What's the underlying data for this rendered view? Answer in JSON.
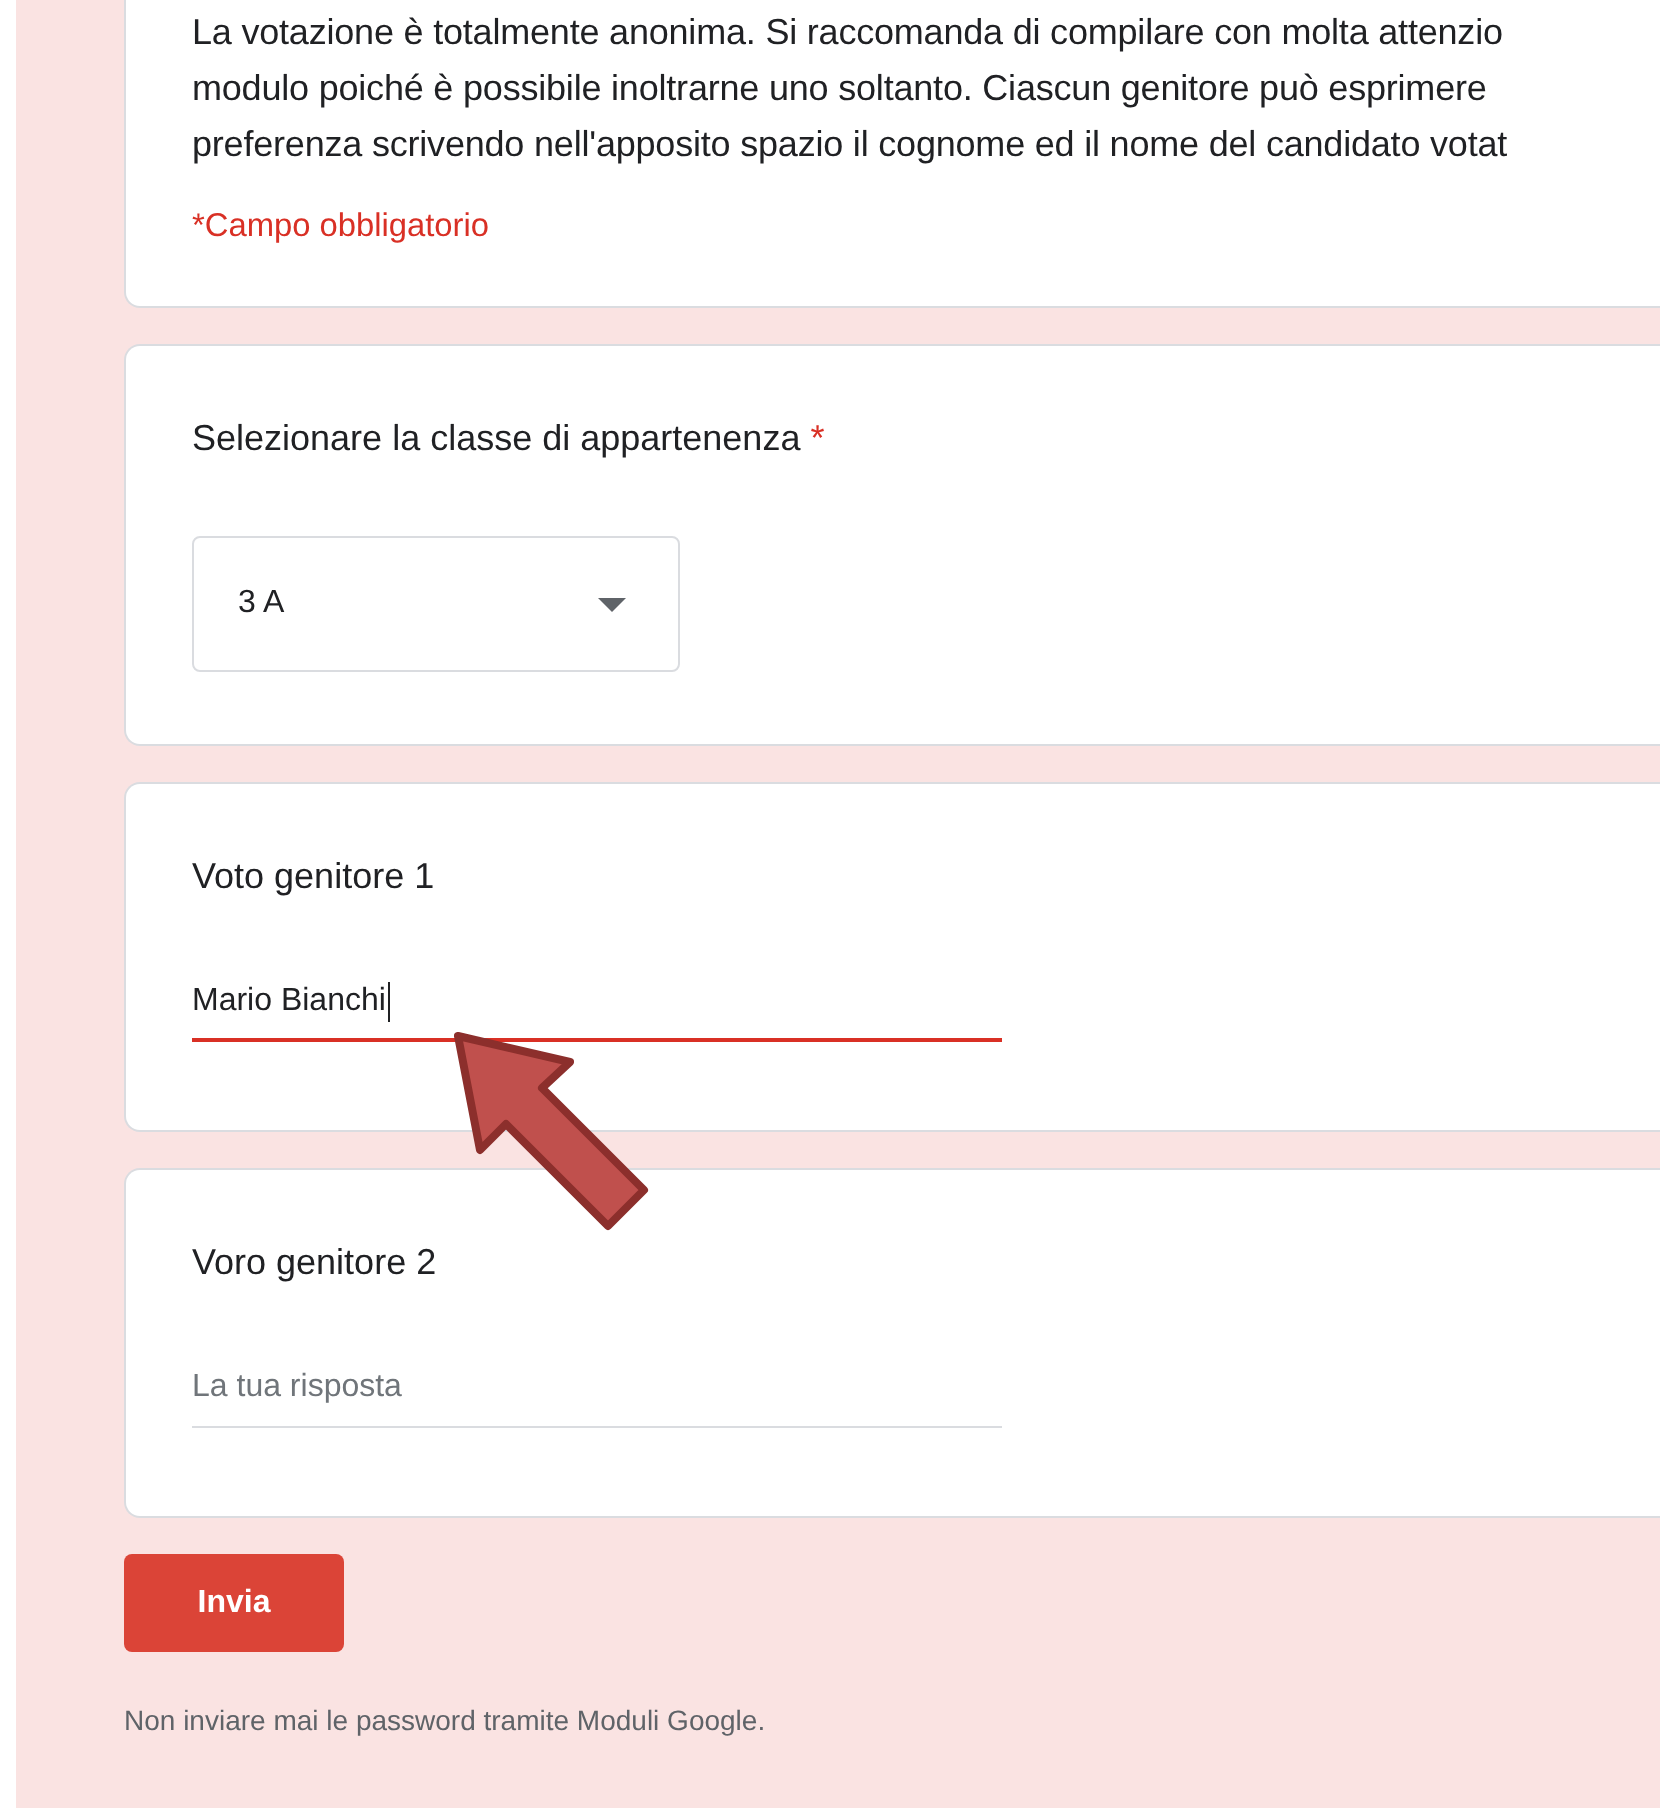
{
  "intro": {
    "description_lines": [
      "La votazione è totalmente anonima. Si raccomanda di compilare con molta attenzio",
      "modulo poiché è possibile inoltrarne uno soltanto. Ciascun genitore può esprimere",
      "preferenza scrivendo nell'apposito spazio il cognome ed il nome del candidato votat"
    ],
    "required_note": "*Campo obbligatorio"
  },
  "questions": [
    {
      "kind": "dropdown",
      "title": "Selezionare la classe di appartenenza",
      "required_mark": "*",
      "value": "3 A"
    },
    {
      "kind": "text",
      "title": "Voto genitore 1",
      "value": "Mario Bianchi",
      "focused": true
    },
    {
      "kind": "text",
      "title": "Voro genitore 2",
      "placeholder": "La tua risposta",
      "focused": false
    }
  ],
  "submit": "Invia",
  "footer": "Non inviare mai le password tramite Moduli Google.",
  "annotation_arrow": true
}
